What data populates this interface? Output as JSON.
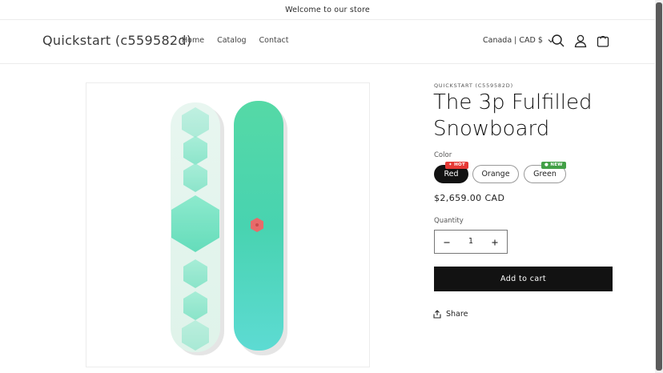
{
  "announcement": "Welcome to our store",
  "header": {
    "logo": "Quickstart (c559582d)",
    "nav": [
      "Home",
      "Catalog",
      "Contact"
    ],
    "currency": "Canada | CAD $",
    "icons": [
      "search-icon",
      "account-icon",
      "cart-icon"
    ]
  },
  "product": {
    "vendor": "QUICKSTART (C559582D)",
    "title": "The 3p Fulfilled Snowboard",
    "color_label": "Color",
    "colors": [
      {
        "label": "Red",
        "selected": true,
        "badge": "HOT"
      },
      {
        "label": "Orange",
        "selected": false,
        "badge": ""
      },
      {
        "label": "Green",
        "selected": false,
        "badge": "NEW"
      }
    ],
    "price": "$2,659.00 CAD",
    "quantity_label": "Quantity",
    "quantity": "1",
    "add_to_cart": "Add to cart",
    "share": "Share"
  },
  "colors": {
    "accent_dark": "#121212",
    "badge_hot": "#e53935",
    "badge_new": "#43a047",
    "board_mint": "#e6f6ef",
    "board_teal": "#4fd8b0"
  }
}
